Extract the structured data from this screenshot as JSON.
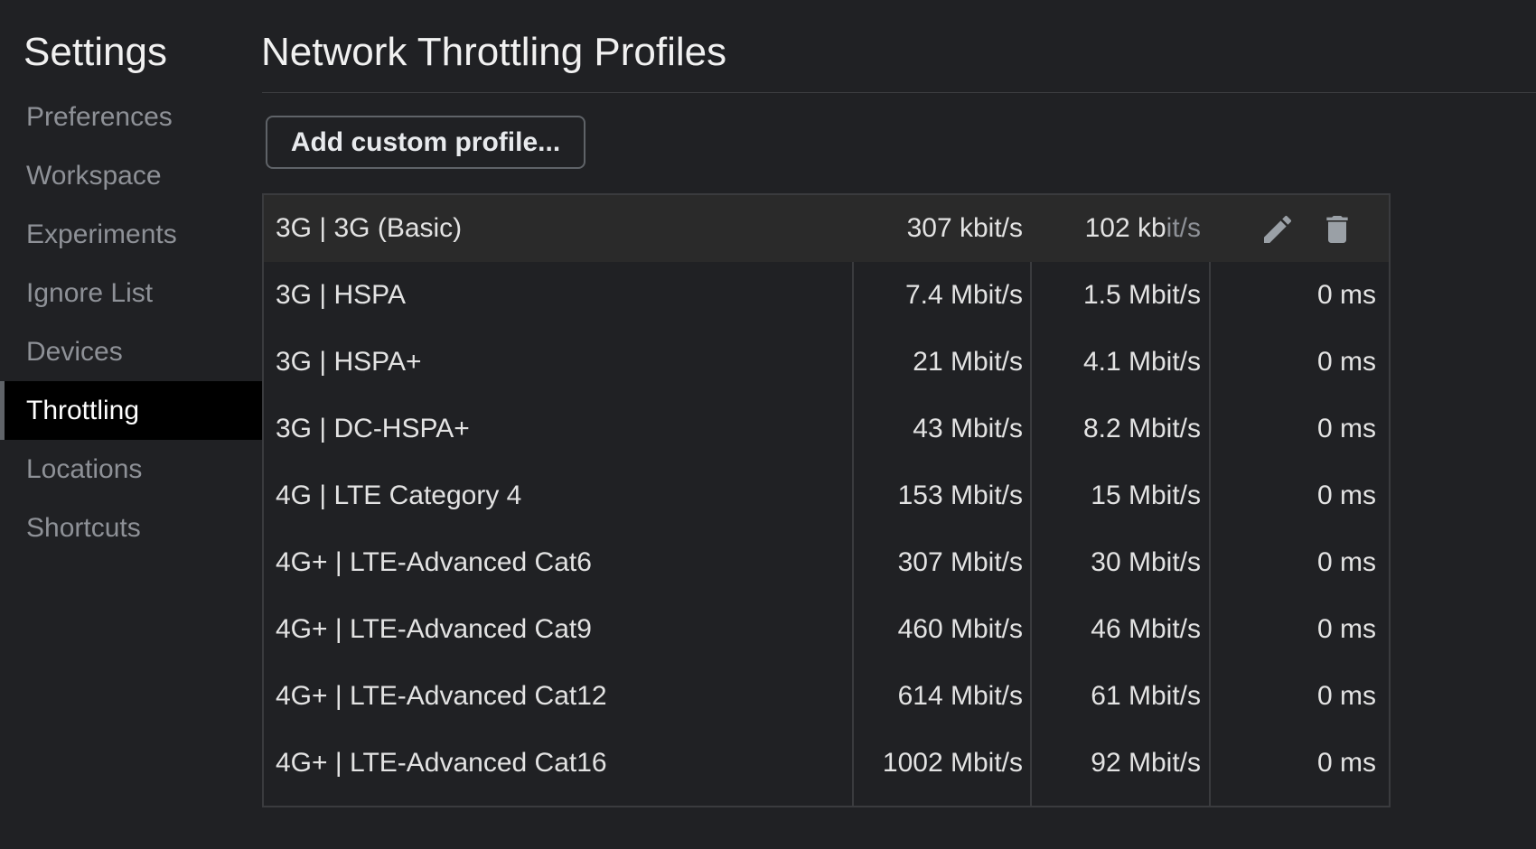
{
  "sidebar": {
    "title": "Settings",
    "items": [
      {
        "label": "Preferences"
      },
      {
        "label": "Workspace"
      },
      {
        "label": "Experiments"
      },
      {
        "label": "Ignore List"
      },
      {
        "label": "Devices"
      },
      {
        "label": "Throttling"
      },
      {
        "label": "Locations"
      },
      {
        "label": "Shortcuts"
      }
    ],
    "selected": "Throttling"
  },
  "main": {
    "title": "Network Throttling Profiles",
    "add_button_label": "Add custom profile...",
    "profiles": [
      {
        "name": "3G | 3G (Basic)",
        "download": "307 kbit/s",
        "upload_main": "102 kb",
        "upload_faded": "it/s",
        "latency": ""
      },
      {
        "name": "3G | HSPA",
        "download": "7.4 Mbit/s",
        "upload": "1.5 Mbit/s",
        "latency": "0 ms"
      },
      {
        "name": "3G | HSPA+",
        "download": "21 Mbit/s",
        "upload": "4.1 Mbit/s",
        "latency": "0 ms"
      },
      {
        "name": "3G | DC-HSPA+",
        "download": "43 Mbit/s",
        "upload": "8.2 Mbit/s",
        "latency": "0 ms"
      },
      {
        "name": "4G | LTE Category 4",
        "download": "153 Mbit/s",
        "upload": "15 Mbit/s",
        "latency": "0 ms"
      },
      {
        "name": "4G+ | LTE-Advanced Cat6",
        "download": "307 Mbit/s",
        "upload": "30 Mbit/s",
        "latency": "0 ms"
      },
      {
        "name": "4G+ | LTE-Advanced Cat9",
        "download": "460 Mbit/s",
        "upload": "46 Mbit/s",
        "latency": "0 ms"
      },
      {
        "name": "4G+ | LTE-Advanced Cat12",
        "download": "614 Mbit/s",
        "upload": "61 Mbit/s",
        "latency": "0 ms"
      },
      {
        "name": "4G+ | LTE-Advanced Cat16",
        "download": "1002 Mbit/s",
        "upload": "92 Mbit/s",
        "latency": "0 ms"
      }
    ],
    "row_actions": [
      {
        "icon": "pencil-icon"
      },
      {
        "icon": "trash-icon"
      }
    ]
  },
  "colors": {
    "background": "#202124",
    "selected_nav_background": "#000000",
    "muted_text": "#8e9197",
    "text": "#e3e3e3"
  }
}
